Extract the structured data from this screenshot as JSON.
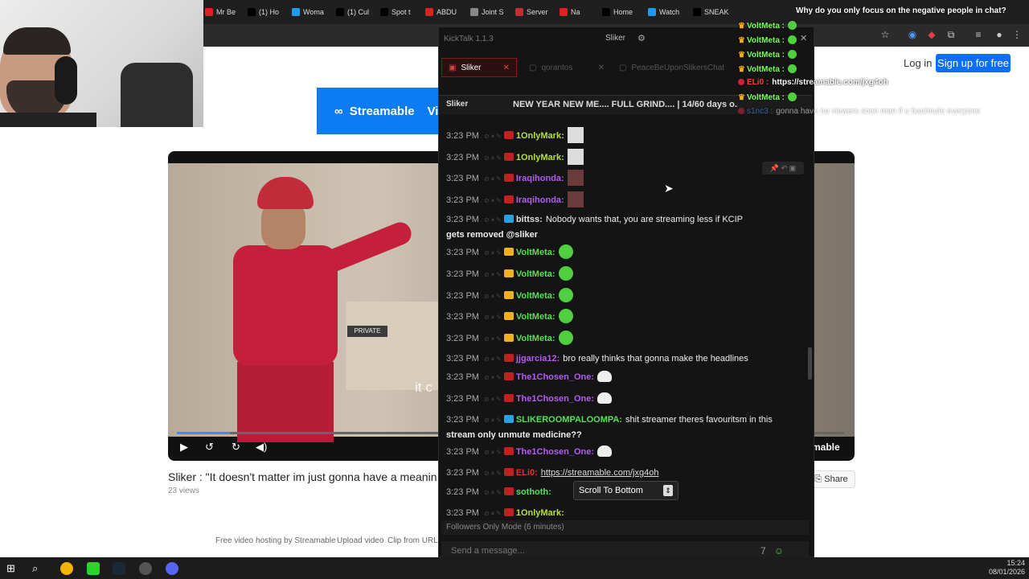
{
  "browser": {
    "tabs": [
      {
        "label": "Mr Be",
        "color": "#e02020"
      },
      {
        "label": "(1) Ho",
        "color": "#000000"
      },
      {
        "label": "Woma",
        "color": "#1d9bf0"
      },
      {
        "label": "(1) Cul",
        "color": "#000000"
      },
      {
        "label": "Spot t",
        "color": "#000000"
      },
      {
        "label": "ABDU",
        "color": "#e02020"
      },
      {
        "label": "Joint S",
        "color": "#888888"
      },
      {
        "label": "Server",
        "color": "#c03030"
      },
      {
        "label": "Na",
        "color": "#e02020"
      },
      {
        "label": "Home",
        "color": "#000000"
      },
      {
        "label": "Watch",
        "color": "#1d9bf0"
      },
      {
        "label": "SNEAK",
        "color": "#000000"
      }
    ]
  },
  "page": {
    "login": "Log in",
    "signup": "Sign up for free",
    "banner_logo": "Streamable",
    "banner_extra": "Vi",
    "video_title": "Sliker : \"It doesn't matter im just gonna have a meanin",
    "views": "23 views",
    "share": "Share",
    "subtitle_text": "it c",
    "player_brand": "mable",
    "private_sign": "PRIVATE",
    "progress_fraction": 0.08,
    "footer": [
      "Free video hosting by Streamable",
      "Upload video",
      "Clip from URL"
    ]
  },
  "kicktalk": {
    "app_title": "KickTalk 1.1.3",
    "user": "Sliker",
    "tabs": [
      "Sliker",
      "qorantos",
      "PeaceBeUponSlikersChat"
    ],
    "stream_name": "Sliker",
    "stream_title": "NEW YEAR NEW ME.... FULL GRIND.... | 14/60 days o...",
    "messages": [
      {
        "time": "3:23 PM",
        "user": "1OnlyMark:",
        "color": "#b6e03a",
        "text": "",
        "extra": "avatar"
      },
      {
        "time": "3:23 PM",
        "user": "1OnlyMark:",
        "color": "#b6e03a",
        "text": "",
        "extra": "avatar"
      },
      {
        "time": "3:23 PM",
        "user": "Iraqihonda:",
        "color": "#b25cf0",
        "text": "",
        "extra": "avatar-dark"
      },
      {
        "time": "3:23 PM",
        "user": "Iraqihonda:",
        "color": "#b25cf0",
        "text": "",
        "extra": "avatar-dark"
      },
      {
        "time": "3:23 PM",
        "user": "bittss:",
        "color": "#e0e0e0",
        "text": "Nobody wants that, you are streaming less if KCIP",
        "line2": "gets removed @sliker"
      },
      {
        "time": "3:23 PM",
        "user": "VoltMeta:",
        "color": "#55e055",
        "text": "",
        "extra": "emote"
      },
      {
        "time": "3:23 PM",
        "user": "VoltMeta:",
        "color": "#55e055",
        "text": "",
        "extra": "emote"
      },
      {
        "time": "3:23 PM",
        "user": "VoltMeta:",
        "color": "#55e055",
        "text": "",
        "extra": "emote"
      },
      {
        "time": "3:23 PM",
        "user": "VoltMeta:",
        "color": "#55e055",
        "text": "",
        "extra": "emote"
      },
      {
        "time": "3:23 PM",
        "user": "VoltMeta:",
        "color": "#55e055",
        "text": "",
        "extra": "emote"
      },
      {
        "time": "3:23 PM",
        "user": "jjgarcia12:",
        "color": "#b25cf0",
        "text": "bro really thinks that gonna make the headlines"
      },
      {
        "time": "3:23 PM",
        "user": "The1Chosen_One:",
        "color": "#b25cf0",
        "text": "",
        "extra": "ghost"
      },
      {
        "time": "3:23 PM",
        "user": "The1Chosen_One:",
        "color": "#b25cf0",
        "text": "",
        "extra": "ghost"
      },
      {
        "time": "3:23 PM",
        "user": "SLIKEROOMPALOOMPA:",
        "color": "#55e055",
        "text": "shit streamer theres favouritsm in this",
        "line2": "stream only unmute medicine??"
      },
      {
        "time": "3:23 PM",
        "user": "The1Chosen_One:",
        "color": "#b25cf0",
        "text": "",
        "extra": "ghost"
      },
      {
        "time": "3:23 PM",
        "user": "ELi0:",
        "color": "#e03030",
        "text": "https://streamable.com/jxg4oh"
      },
      {
        "time": "3:23 PM",
        "user": "sothoth:",
        "color": "#55e055",
        "text": ""
      },
      {
        "time": "3:23 PM",
        "user": "1OnlyMark:",
        "color": "#b6e03a",
        "text": ""
      }
    ],
    "scroll_to_bottom": "Scroll To Bottom",
    "followers_mode": "Followers Only Mode (6 minutes)",
    "input_placeholder": "Send a message..."
  },
  "overlay": {
    "top_question": "Why do you only focus on the negative people in chat?",
    "rows": [
      {
        "user": "VoltMeta :",
        "text": ""
      },
      {
        "user": "VoltMeta :",
        "text": ""
      },
      {
        "user": "VoltMeta :",
        "text": ""
      },
      {
        "user": "VoltMeta :",
        "text": ""
      },
      {
        "user": "ELi0 :",
        "text": "https://streamable.com/jxg4oh"
      },
      {
        "user": "VoltMeta :",
        "text": ""
      },
      {
        "user": "s1nc3 :",
        "text": "gonna have no viewers soon man if u ban/mute everyone"
      }
    ]
  },
  "taskbar": {
    "time": "15:24",
    "date": "08/01/2026"
  }
}
